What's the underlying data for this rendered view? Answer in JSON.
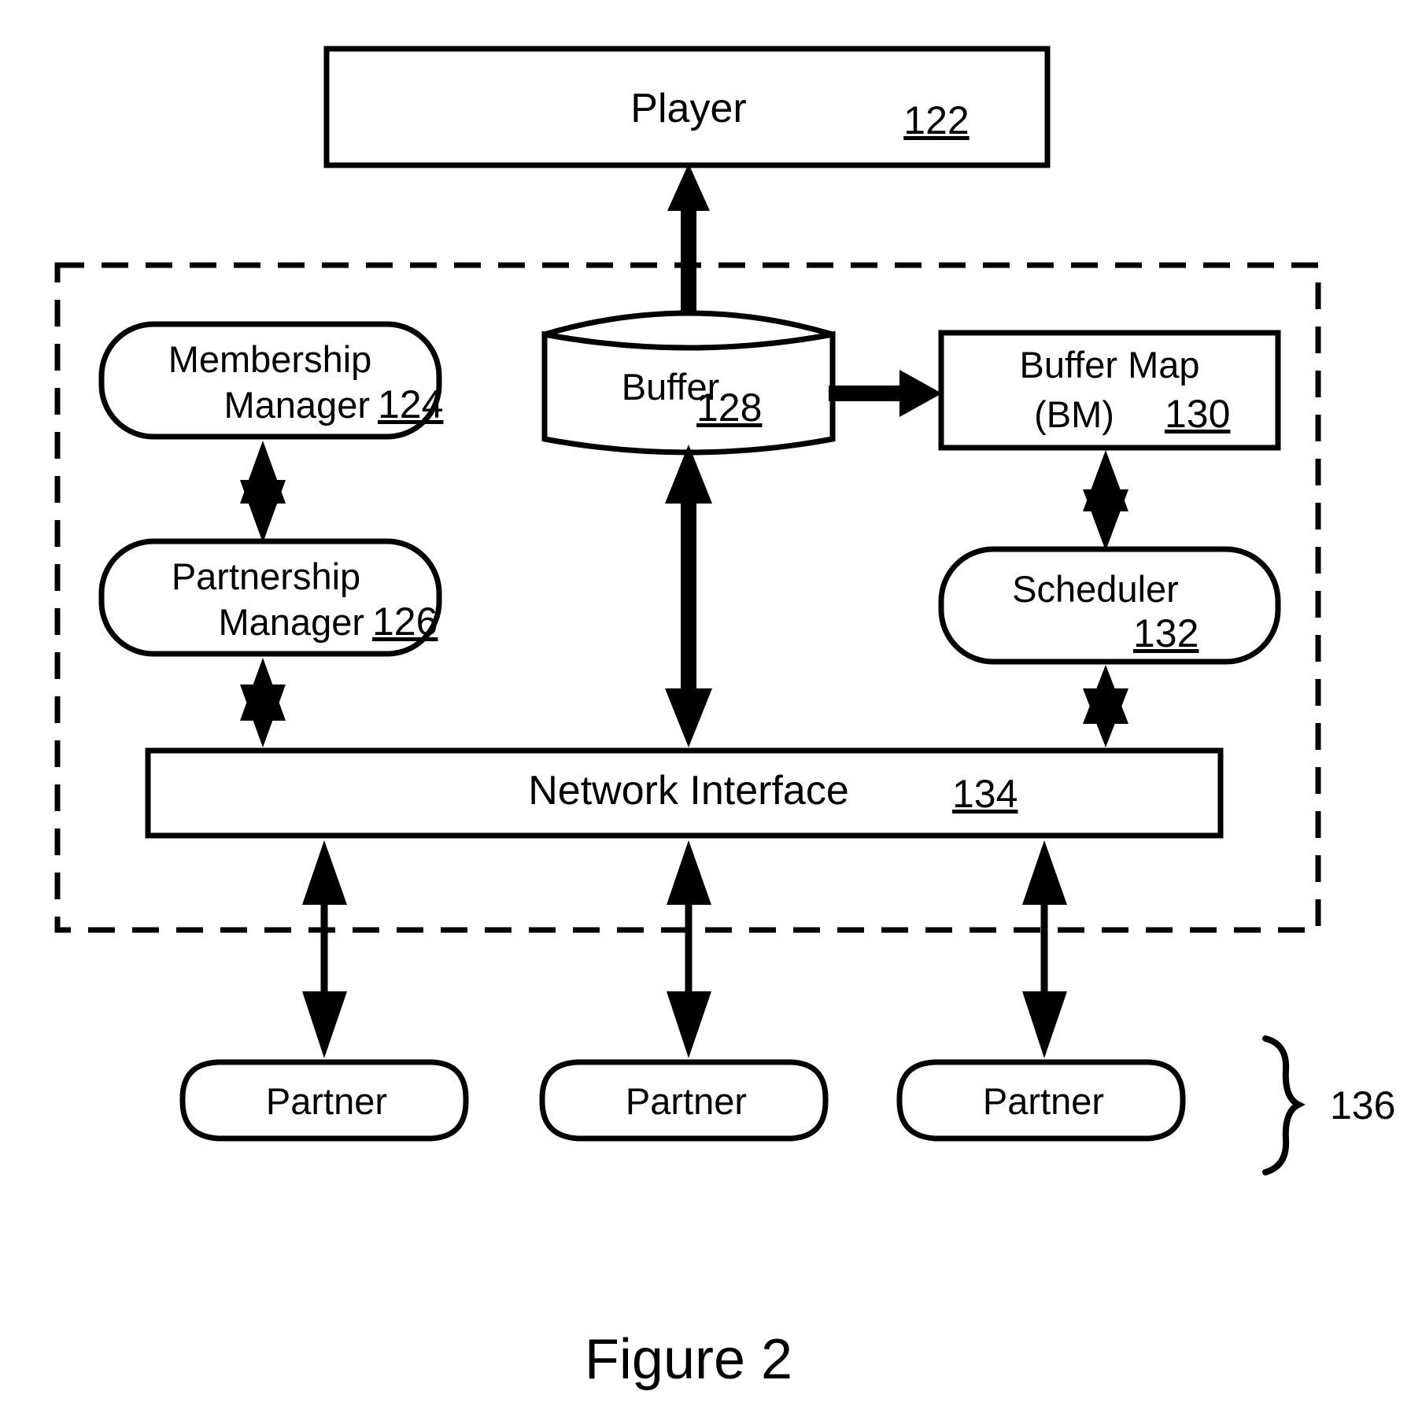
{
  "figure": {
    "caption": "Figure 2",
    "title_number": "2"
  },
  "nodes": {
    "player": {
      "label": "Player",
      "ref": "122",
      "shape": "rectangle"
    },
    "membership_manager": {
      "label_line1": "Membership",
      "label_line2": "Manager",
      "ref": "124",
      "shape": "rounded-rectangle"
    },
    "partnership_manager": {
      "label_line1": "Partnership",
      "label_line2": "Manager",
      "ref": "126",
      "shape": "rounded-rectangle"
    },
    "buffer": {
      "label": "Buffer",
      "ref": "128",
      "shape": "cylinder"
    },
    "buffer_map": {
      "label_line1": "Buffer Map",
      "label_line2": "(BM)",
      "ref": "130",
      "shape": "rectangle"
    },
    "scheduler": {
      "label": "Scheduler",
      "ref": "132",
      "shape": "rounded-rectangle"
    },
    "network_interface": {
      "label": "Network Interface",
      "ref": "134",
      "shape": "rectangle"
    },
    "partner_1": {
      "label": "Partner",
      "shape": "rounded-rectangle"
    },
    "partner_2": {
      "label": "Partner",
      "shape": "rounded-rectangle"
    },
    "partner_3": {
      "label": "Partner",
      "shape": "rounded-rectangle"
    },
    "partners_group": {
      "ref": "136",
      "shape": "brace"
    }
  },
  "connectors": [
    {
      "name": "buffer-to-player",
      "from": "buffer",
      "to": "player",
      "arrow": "single-up"
    },
    {
      "name": "membership-to-partnership",
      "from": "membership_manager",
      "to": "partnership_manager",
      "arrow": "double"
    },
    {
      "name": "partnership-to-network",
      "from": "partnership_manager",
      "to": "network_interface",
      "arrow": "double"
    },
    {
      "name": "buffer-to-buffermap",
      "from": "buffer",
      "to": "buffer_map",
      "arrow": "single-right"
    },
    {
      "name": "buffer-to-network",
      "from": "buffer",
      "to": "network_interface",
      "arrow": "double"
    },
    {
      "name": "buffermap-to-scheduler",
      "from": "buffer_map",
      "to": "scheduler",
      "arrow": "double"
    },
    {
      "name": "scheduler-to-network",
      "from": "scheduler",
      "to": "network_interface",
      "arrow": "double"
    },
    {
      "name": "network-to-partner-1",
      "from": "network_interface",
      "to": "partner_1",
      "arrow": "double"
    },
    {
      "name": "network-to-partner-2",
      "from": "network_interface",
      "to": "partner_2",
      "arrow": "double"
    },
    {
      "name": "network-to-partner-3",
      "from": "network_interface",
      "to": "partner_3",
      "arrow": "double"
    }
  ],
  "boundary": {
    "name": "peer-node-boundary",
    "style": "dashed"
  },
  "colors": {
    "stroke": "#000000",
    "fill": "#ffffff",
    "background": "#ffffff"
  }
}
